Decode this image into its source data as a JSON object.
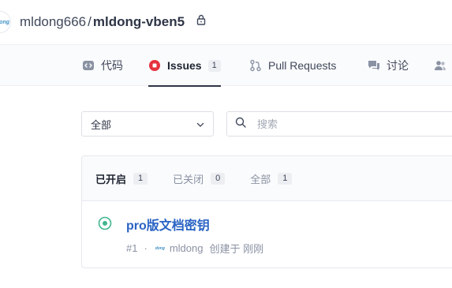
{
  "repo": {
    "owner": "mldong666",
    "separator": "/",
    "name": "mldong-vben5",
    "avatar_text": "dong"
  },
  "tabs": [
    {
      "label": "代码",
      "icon": "code-icon"
    },
    {
      "label": "Issues",
      "count": "1",
      "icon": "issue-icon",
      "active": true
    },
    {
      "label": "Pull Requests",
      "icon": "pull-request-icon"
    },
    {
      "label": "讨论",
      "icon": "discussion-icon"
    },
    {
      "label": "",
      "icon": "members-icon"
    }
  ],
  "filters": {
    "select_value": "全部",
    "search_placeholder": "搜索"
  },
  "states": [
    {
      "label": "已开启",
      "count": "1",
      "active": true
    },
    {
      "label": "已关闭",
      "count": "0"
    },
    {
      "label": "全部",
      "count": "1"
    }
  ],
  "issue": {
    "title": "pro版文档密钥",
    "number": "#1",
    "separator": "·",
    "author": "mldong",
    "author_avatar_text": "dong",
    "created": "创建于 刚刚"
  },
  "colors": {
    "accent": "#e5323e",
    "link": "#2a63c4",
    "open_state": "#3fb68b"
  }
}
